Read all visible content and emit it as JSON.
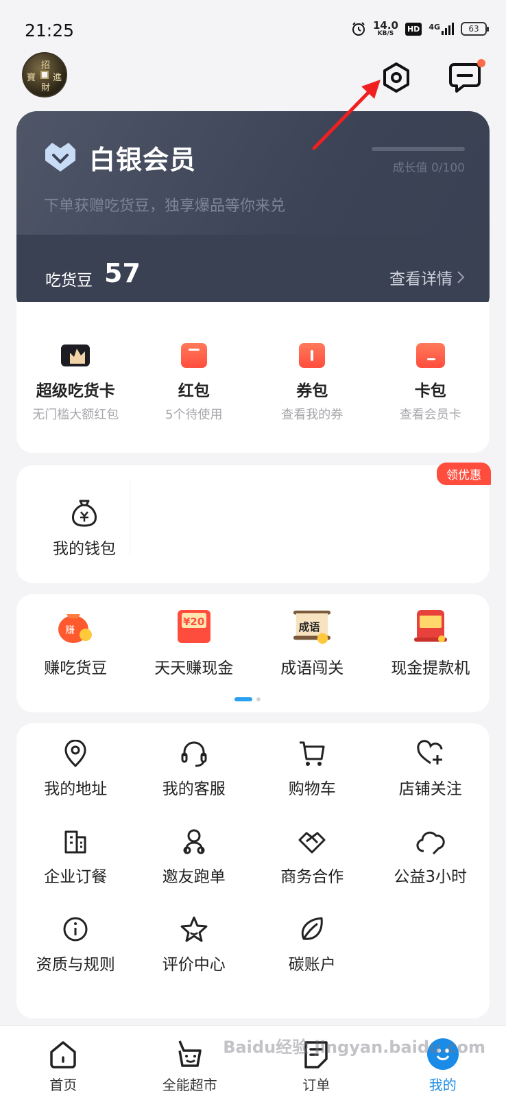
{
  "status_bar": {
    "time": "21:25",
    "net_speed_value": "14.0",
    "net_speed_unit": "KB/S",
    "hd": "HD",
    "network": "4G",
    "battery": "63"
  },
  "header": {
    "avatar_text": [
      "招",
      "進",
      "寶",
      "財"
    ],
    "settings_icon": "gear-icon",
    "message_icon": "chat-icon",
    "message_dot_color": "#ff6b4a"
  },
  "member_card": {
    "tier": "白银会员",
    "subtitle": "下单获赠吃货豆，独享爆品等你来兑",
    "growth": "成长值 0/100",
    "beans_label": "吃货豆",
    "beans_value": "57",
    "details_label": "查看详情"
  },
  "benefits": [
    {
      "label": "超级吃货卡",
      "sub": "无门槛大额红包",
      "icon": "crown-card-icon"
    },
    {
      "label": "红包",
      "sub": "5个待使用",
      "icon": "red-envelope-icon"
    },
    {
      "label": "券包",
      "sub": "查看我的券",
      "icon": "coupon-icon"
    },
    {
      "label": "卡包",
      "sub": "查看会员卡",
      "icon": "card-icon"
    }
  ],
  "wallet": {
    "label": "我的钱包",
    "promo": "领优惠"
  },
  "activities": [
    {
      "label": "赚吃货豆",
      "icon": "money-bag-icon",
      "badge": "赚"
    },
    {
      "label": "天天赚现金",
      "icon": "cash-envelope-icon",
      "badge": "¥20"
    },
    {
      "label": "成语闯关",
      "icon": "idiom-scroll-icon",
      "badge": "成语"
    },
    {
      "label": "现金提款机",
      "icon": "atm-icon",
      "badge": ""
    }
  ],
  "services": [
    {
      "label": "我的地址",
      "icon": "location-icon"
    },
    {
      "label": "我的客服",
      "icon": "headset-icon"
    },
    {
      "label": "购物车",
      "icon": "cart-icon"
    },
    {
      "label": "店铺关注",
      "icon": "heart-plus-icon"
    },
    {
      "label": "企业订餐",
      "icon": "building-icon"
    },
    {
      "label": "邀友跑单",
      "icon": "rider-icon"
    },
    {
      "label": "商务合作",
      "icon": "handshake-icon"
    },
    {
      "label": "公益3小时",
      "icon": "cloud-icon"
    },
    {
      "label": "资质与规则",
      "icon": "info-icon"
    },
    {
      "label": "评价中心",
      "icon": "star-icon"
    },
    {
      "label": "碳账户",
      "icon": "leaf-icon"
    }
  ],
  "bottom_nav": [
    {
      "label": "首页",
      "icon": "home-icon"
    },
    {
      "label": "全能超市",
      "icon": "basket-icon"
    },
    {
      "label": "订单",
      "icon": "order-icon"
    },
    {
      "label": "我的",
      "icon": "profile-icon"
    }
  ],
  "watermark": "Baidu经验 jingyan.baidu.com",
  "colors": {
    "accent": "#1a8be6",
    "card_bg": "#3c4356",
    "red": "#ff4d3d",
    "arrow": "#f02020"
  }
}
